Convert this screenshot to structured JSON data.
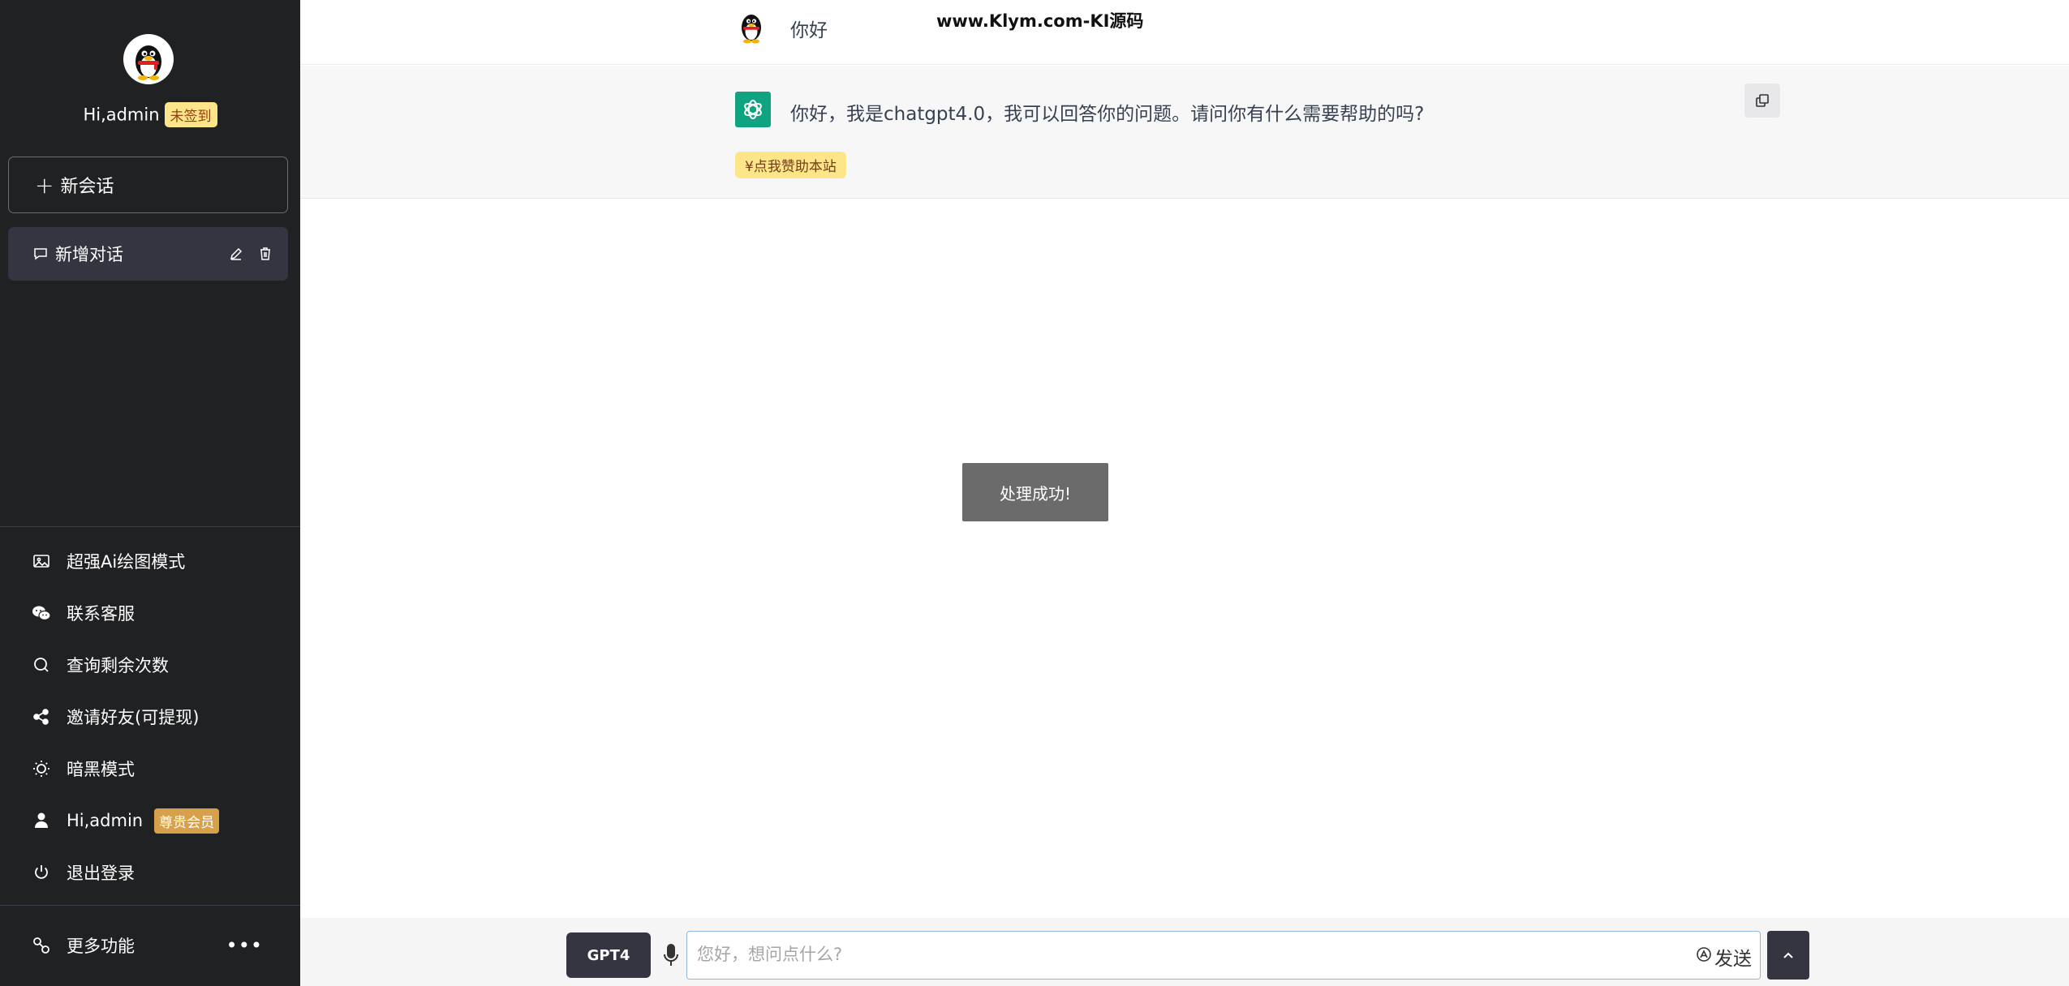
{
  "sidebar": {
    "greeting": "Hi,admin",
    "sign_status": "未签到",
    "new_chat_label": "新会话",
    "conversations": [
      {
        "label": "新增对话"
      }
    ],
    "menu": [
      {
        "label": "超强Ai绘图模式",
        "icon": "image-icon"
      },
      {
        "label": "联系客服",
        "icon": "wechat-icon"
      },
      {
        "label": "查询剩余次数",
        "icon": "search-icon"
      },
      {
        "label": "邀请好友(可提现)",
        "icon": "share-icon"
      },
      {
        "label": "暗黑模式",
        "icon": "sun-icon"
      },
      {
        "label": "Hi,admin",
        "icon": "user-icon",
        "badge": "尊贵会员"
      },
      {
        "label": "退出登录",
        "icon": "power-icon"
      }
    ],
    "more_label": "更多功能"
  },
  "chat": {
    "watermark": "www.Klym.com-KI源码",
    "messages": [
      {
        "role": "user",
        "text": "你好"
      },
      {
        "role": "assistant",
        "text": "你好，我是chatgpt4.0，我可以回答你的问题。请问你有什么需要帮助的吗?"
      }
    ],
    "donate_label": "¥点我赞助本站"
  },
  "toast": "处理成功!",
  "composer": {
    "model_label": "GPT4",
    "placeholder": "您好，想问点什么?",
    "send_label": "发送"
  },
  "colors": {
    "sidebar_bg": "#202123",
    "active_item_bg": "#343541",
    "bot_row_bg": "#f7f7f8",
    "openai_green": "#10a37f",
    "badge_yellow": "#fde68a",
    "badge_orange": "#d6a14a"
  }
}
